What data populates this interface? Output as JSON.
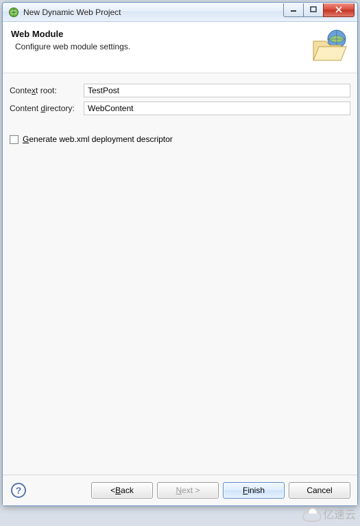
{
  "window": {
    "title": "New Dynamic Web Project"
  },
  "header": {
    "title": "Web Module",
    "subtitle": "Configure web module settings."
  },
  "form": {
    "context_root": {
      "label": "Context root:",
      "value": "TestPost"
    },
    "content_directory": {
      "label_pre": "Content ",
      "label_ul": "d",
      "label_post": "irectory:",
      "value": "WebContent"
    },
    "gen_web_xml": {
      "label_ul": "G",
      "label_post": "enerate web.xml deployment descriptor",
      "checked": false
    }
  },
  "buttons": {
    "back": {
      "pre": "< ",
      "ul": "B",
      "post": "ack"
    },
    "next": {
      "ul": "N",
      "post": "ext >"
    },
    "finish": {
      "ul": "F",
      "post": "inish"
    },
    "cancel": "Cancel"
  },
  "watermark": "亿速云"
}
